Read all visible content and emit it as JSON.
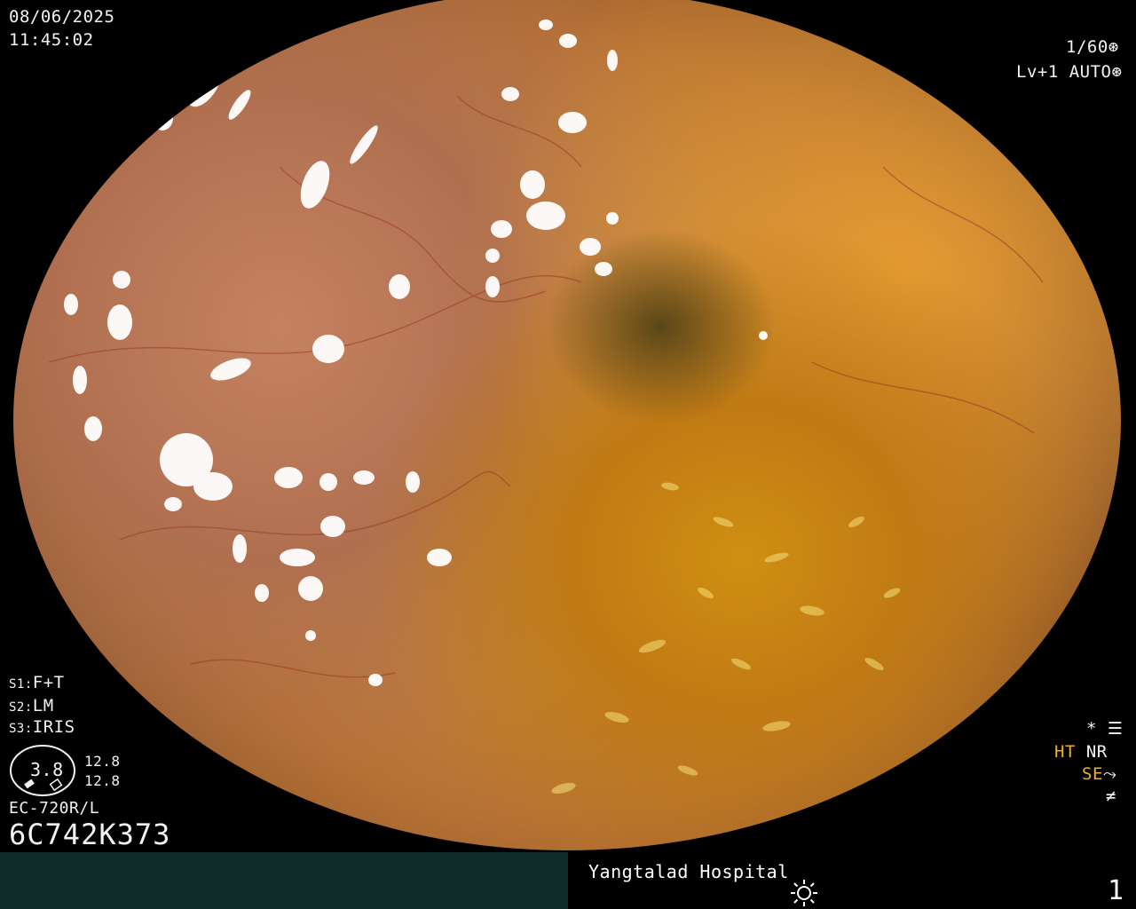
{
  "overlay": {
    "date": "08/06/2025",
    "time": "11:45:02",
    "shutter": "1/60",
    "level": "Lv+1",
    "mode": "AUTO",
    "s1_label": "S1:",
    "s1_value": "F+T",
    "s2_label": "S2:",
    "s2_value": "LM",
    "s3_label": "S3:",
    "s3_value": "IRIS",
    "gauge_value": "3.8",
    "gauge_top": "12.8",
    "gauge_bottom": "12.8",
    "scope_model": "EC-720R/L",
    "serial": "6C742K373",
    "ht": "HT",
    "nr": "NR",
    "se": "SE",
    "asterisk": "*"
  },
  "footer": {
    "hospital": "Yangtalad Hospital",
    "page_number": "1"
  },
  "colors": {
    "bottom_bar": "#0f2b2a",
    "accent_orange": "#f0b020",
    "osd_text": "#f2f2f2"
  }
}
